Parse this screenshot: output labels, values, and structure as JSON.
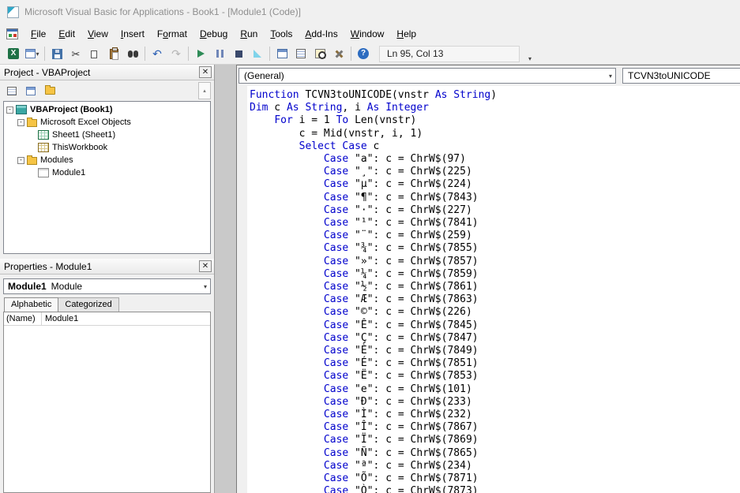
{
  "window": {
    "title": "Microsoft Visual Basic for Applications - Book1 - [Module1 (Code)]"
  },
  "menu": {
    "items": [
      {
        "label": "File",
        "u": 0
      },
      {
        "label": "Edit",
        "u": 0
      },
      {
        "label": "View",
        "u": 0
      },
      {
        "label": "Insert",
        "u": 0
      },
      {
        "label": "Format",
        "u": 1
      },
      {
        "label": "Debug",
        "u": 0
      },
      {
        "label": "Run",
        "u": 0
      },
      {
        "label": "Tools",
        "u": 0
      },
      {
        "label": "Add-Ins",
        "u": 0
      },
      {
        "label": "Window",
        "u": 0
      },
      {
        "label": "Help",
        "u": 0
      }
    ]
  },
  "toolbar": {
    "status": "Ln 95, Col 13",
    "icons": [
      "view-microsoft-excel",
      "insert-userform",
      "save",
      "cut",
      "copy",
      "paste",
      "find",
      "undo",
      "redo",
      "run-sub",
      "break",
      "reset",
      "design-mode",
      "project-explorer",
      "properties-window",
      "object-browser",
      "toolbox",
      "help"
    ]
  },
  "project_panel": {
    "title": "Project - VBAProject",
    "toolbar_icons": [
      "view-code",
      "view-object",
      "toggle-folders"
    ],
    "tree": [
      {
        "label": "VBAProject (Book1)",
        "icon": "project",
        "indent": 0,
        "expander": "-",
        "bold": true
      },
      {
        "label": "Microsoft Excel Objects",
        "icon": "folder",
        "indent": 1,
        "expander": "-"
      },
      {
        "label": "Sheet1 (Sheet1)",
        "icon": "sheet",
        "indent": 2
      },
      {
        "label": "ThisWorkbook",
        "icon": "workbook",
        "indent": 2
      },
      {
        "label": "Modules",
        "icon": "folder",
        "indent": 1,
        "expander": "-"
      },
      {
        "label": "Module1",
        "icon": "module",
        "indent": 2
      }
    ]
  },
  "properties_panel": {
    "title": "Properties - Module1",
    "object": "Module1",
    "object_type": "Module",
    "tabs": [
      "Alphabetic",
      "Categorized"
    ],
    "rows": [
      {
        "name": "(Name)",
        "value": "Module1"
      }
    ]
  },
  "code_window": {
    "object_combo": "(General)",
    "procedure_combo": "TCVN3toUNICODE",
    "keyword_color": "#0000cc",
    "lines": [
      "Function TCVN3toUNICODE(vnstr As String)",
      "Dim c As String, i As Integer",
      "    For i = 1 To Len(vnstr)",
      "        c = Mid(vnstr, i, 1)",
      "        Select Case c",
      "            Case \"a\": c = ChrW$(97)",
      "            Case \"¸\": c = ChrW$(225)",
      "            Case \"µ\": c = ChrW$(224)",
      "            Case \"¶\": c = ChrW$(7843)",
      "            Case \"·\": c = ChrW$(227)",
      "            Case \"¹\": c = ChrW$(7841)",
      "            Case \"¨\": c = ChrW$(259)",
      "            Case \"¾\": c = ChrW$(7855)",
      "            Case \"»\": c = ChrW$(7857)",
      "            Case \"¼\": c = ChrW$(7859)",
      "            Case \"½\": c = ChrW$(7861)",
      "            Case \"Æ\": c = ChrW$(7863)",
      "            Case \"©\": c = ChrW$(226)",
      "            Case \"Ê\": c = ChrW$(7845)",
      "            Case \"Ç\": c = ChrW$(7847)",
      "            Case \"È\": c = ChrW$(7849)",
      "            Case \"É\": c = ChrW$(7851)",
      "            Case \"Ë\": c = ChrW$(7853)",
      "            Case \"e\": c = ChrW$(101)",
      "            Case \"Ð\": c = ChrW$(233)",
      "            Case \"Ì\": c = ChrW$(232)",
      "            Case \"Î\": c = ChrW$(7867)",
      "            Case \"Ï\": c = ChrW$(7869)",
      "            Case \"Ñ\": c = ChrW$(7865)",
      "            Case \"ª\": c = ChrW$(234)",
      "            Case \"Õ\": c = ChrW$(7871)",
      "            Case \"Ò\": c = ChrW$(7873)"
    ]
  }
}
